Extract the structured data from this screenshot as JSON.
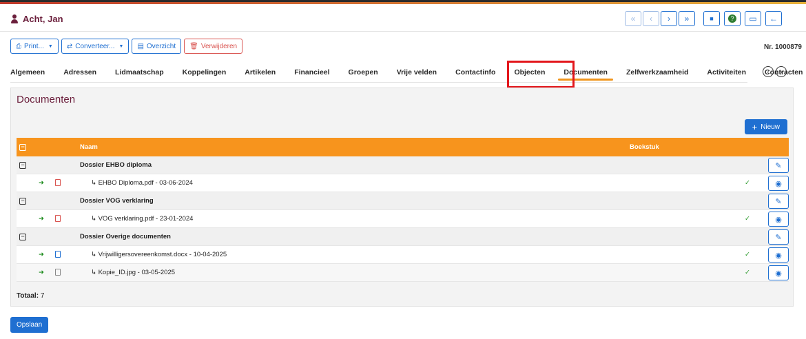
{
  "header": {
    "title": "Acht, Jan",
    "icons": {
      "person": "person-icon"
    }
  },
  "nav": {
    "first": "«",
    "prev": "‹",
    "next": "›",
    "last": "»",
    "save": "■",
    "help": "?",
    "comment": "▭",
    "back": "←"
  },
  "toolbar": {
    "print_label": "Print...",
    "convert_label": "Converteer...",
    "overview_label": "Overzicht",
    "delete_label": "Verwijderen",
    "record_number": "Nr. 1000879"
  },
  "tabs": [
    {
      "label": "Algemeen"
    },
    {
      "label": "Adressen"
    },
    {
      "label": "Lidmaatschap"
    },
    {
      "label": "Koppelingen"
    },
    {
      "label": "Artikelen"
    },
    {
      "label": "Financieel"
    },
    {
      "label": "Groepen"
    },
    {
      "label": "Vrije velden"
    },
    {
      "label": "Contactinfo"
    },
    {
      "label": "Objecten"
    },
    {
      "label": "Documenten"
    },
    {
      "label": "Zelfwerkzaamheid"
    },
    {
      "label": "Activiteiten"
    },
    {
      "label": "Contracten"
    }
  ],
  "panel": {
    "title": "Documenten",
    "new_label": "Nieuw",
    "columns": {
      "name": "Naam",
      "booking": "Boekstuk"
    },
    "groups": [
      {
        "name": "Dossier EHBO diploma",
        "items": [
          {
            "file": "↳ EHBO Diploma.pdf - 03-06-2024",
            "type": "pdf",
            "check": "✓"
          }
        ]
      },
      {
        "name": "Dossier VOG verklaring",
        "items": [
          {
            "file": "↳ VOG verklaring.pdf - 23-01-2024",
            "type": "pdf",
            "check": "✓"
          }
        ]
      },
      {
        "name": "Dossier Overige documenten",
        "items": [
          {
            "file": "↳ Vrijwilligersovereenkomst.docx - 10-04-2025",
            "type": "docx",
            "check": "✓"
          },
          {
            "file": "↳ Kopie_ID.jpg - 03-05-2025",
            "type": "jpg",
            "check": "✓"
          }
        ]
      }
    ],
    "total_label": "Totaal:",
    "total_value": "7"
  },
  "footer": {
    "save_label": "Opslaan"
  },
  "colors": {
    "accent": "#1f6fd1",
    "header_orange": "#f7941d",
    "title": "#6b1f3c",
    "highlight": "#e3161b"
  }
}
